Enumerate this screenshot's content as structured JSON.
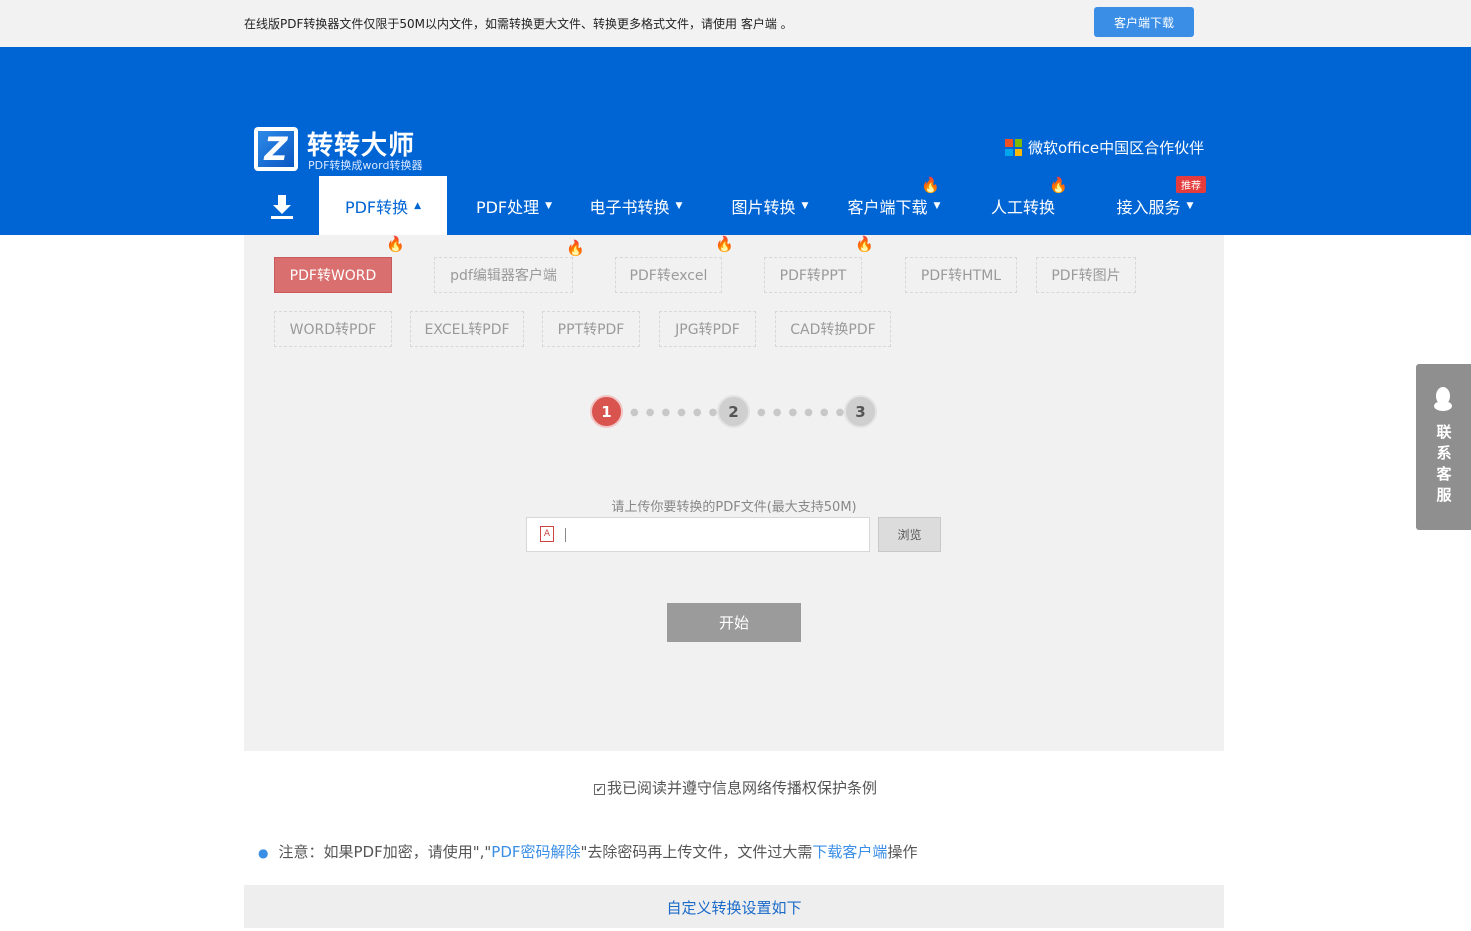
{
  "topbar": {
    "notice": "在线版PDF转换器文件仅限于50M以内文件，如需转换更大文件、转换更多格式文件，请使用 客户端 。",
    "download_button": "客户端下载"
  },
  "header": {
    "logo_letter": "Z",
    "brand_name": "转转大师",
    "brand_sub": "PDF转换成word转换器",
    "partner_text": "微软office中国区合作伙伴",
    "colors": {
      "primary": "#0065d4",
      "active_tool": "#d9706f",
      "link": "#3a8ee6"
    }
  },
  "nav": {
    "download_icon": "download-icon",
    "items": [
      {
        "label": "PDF转换",
        "caret": "▲"
      },
      {
        "label": "PDF处理",
        "caret": "▼"
      },
      {
        "label": "电子书转换",
        "caret": "▼"
      },
      {
        "label": "图片转换",
        "caret": "▼"
      },
      {
        "label": "客户端下载",
        "caret": "▼"
      },
      {
        "label": "人工转换",
        "caret": ""
      },
      {
        "label": "接入服务",
        "caret": "▼"
      }
    ],
    "recommend_badge": "推荐"
  },
  "tools": {
    "row1": [
      "PDF转WORD",
      "pdf编辑器客户端",
      "PDF转excel",
      "PDF转PPT",
      "PDF转HTML",
      "PDF转图片"
    ],
    "row2": [
      "WORD转PDF",
      "EXCEL转PDF",
      "PPT转PDF",
      "JPG转PDF",
      "CAD转换PDF"
    ]
  },
  "steps": [
    "1",
    "2",
    "3"
  ],
  "upload": {
    "label": "请上传你要转换的PDF文件(最大支持50M)",
    "value": "",
    "browse_label": "浏览",
    "file_icon": "pdf-file-icon"
  },
  "start_label": "开始",
  "agreement": "我已阅读并遵守信息网络传播权保护条例",
  "note": {
    "prefix": "注意：如果PDF加密，请使用\",\"",
    "link1": "PDF密码解除",
    "middle": "\"去除密码再上传文件，文件过大需",
    "link2": "下载客户端",
    "suffix": "操作"
  },
  "custom_settings": "自定义转换设置如下",
  "side_service": {
    "icon": "qq-penguin-icon",
    "label": "联系客服"
  }
}
